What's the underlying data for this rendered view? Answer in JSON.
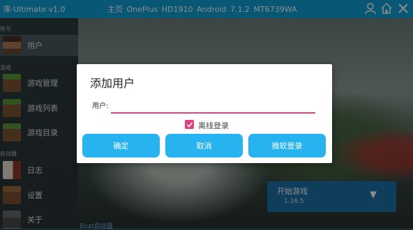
{
  "app": {
    "title": "澪-Ultimate v1.0"
  },
  "device": {
    "info": "主页  OnePlus HD1910 Android 7.1.2  MT6739WA"
  },
  "topbar_icons": [
    "user-icon",
    "home-icon",
    "close-icon"
  ],
  "sidebar": {
    "sections": [
      "账号",
      "游戏",
      "启动器"
    ],
    "items": [
      {
        "label": "用户",
        "icon": "player-head-icon"
      },
      {
        "label": "游戏管理",
        "icon": "grass-block-icon"
      },
      {
        "label": "游戏列表",
        "icon": "grass-block-icon"
      },
      {
        "label": "游戏目录",
        "icon": "grass-block-icon"
      },
      {
        "label": "日志",
        "icon": "book-icon"
      },
      {
        "label": "设置",
        "icon": "crafting-table-icon"
      },
      {
        "label": "关于",
        "icon": "anvil-icon"
      }
    ]
  },
  "launch": {
    "label": "开始游戏",
    "version": "1.16.5"
  },
  "bottom_link": "Boat启动器",
  "dialog": {
    "title": "添加用户",
    "field_label": "用户:",
    "field_value": "",
    "checkbox": {
      "label": "离线登录",
      "checked": true
    },
    "buttons": [
      "确定",
      "取消",
      "微软登录"
    ]
  },
  "colors": {
    "accent": "#0e9fd6",
    "button": "#27b2f0",
    "checkbox": "#e1407c"
  }
}
